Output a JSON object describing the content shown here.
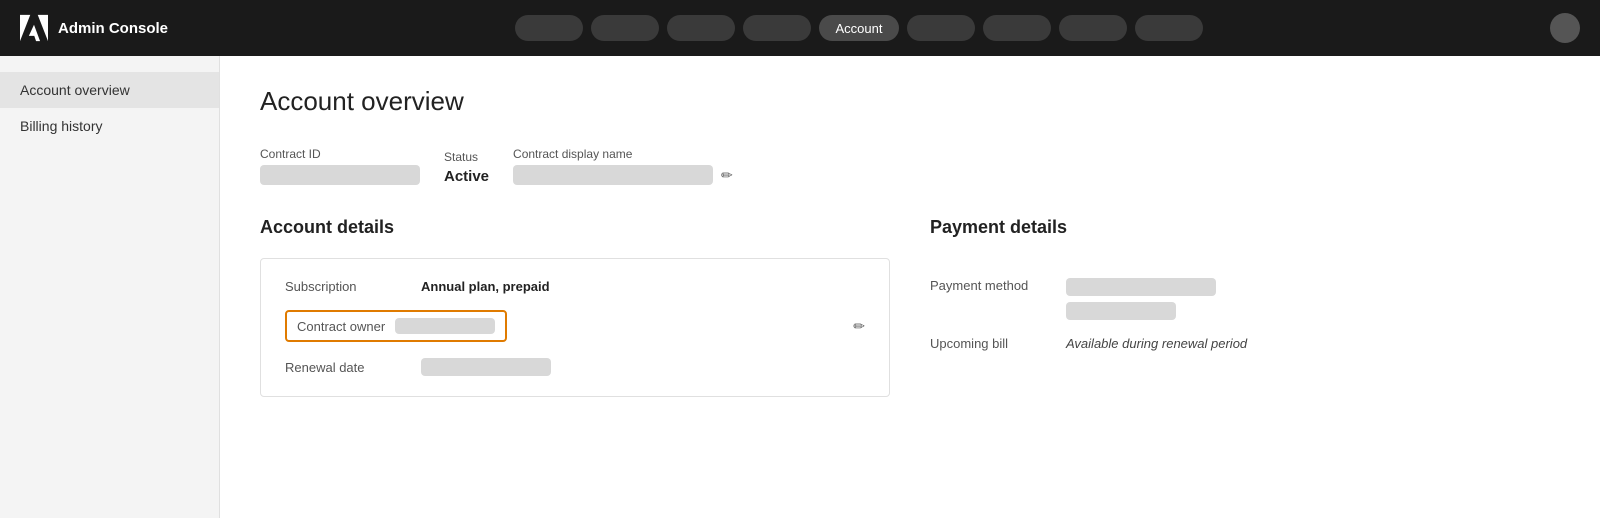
{
  "topnav": {
    "logo_text": "Admin Console",
    "nav_pills": [
      {
        "id": "p1",
        "label": ""
      },
      {
        "id": "p2",
        "label": ""
      },
      {
        "id": "p3",
        "label": ""
      },
      {
        "id": "p4",
        "label": ""
      },
      {
        "id": "p5",
        "label": "Account",
        "active": true
      },
      {
        "id": "p6",
        "label": ""
      },
      {
        "id": "p7",
        "label": ""
      },
      {
        "id": "p8",
        "label": ""
      },
      {
        "id": "p9",
        "label": ""
      }
    ]
  },
  "sidebar": {
    "items": [
      {
        "id": "account-overview",
        "label": "Account overview",
        "active": true
      },
      {
        "id": "billing-history",
        "label": "Billing history",
        "active": false
      }
    ]
  },
  "content": {
    "page_title": "Account overview",
    "contract_id_label": "Contract ID",
    "status_label": "Status",
    "status_value": "Active",
    "contract_display_name_label": "Contract display name",
    "account_details_title": "Account details",
    "subscription_label": "Subscription",
    "subscription_value": "Annual plan, prepaid",
    "contract_owner_label": "Contract owner",
    "renewal_date_label": "Renewal date",
    "payment_details_title": "Payment details",
    "payment_method_label": "Payment method",
    "upcoming_bill_label": "Upcoming bill",
    "upcoming_bill_value": "Available during renewal period"
  }
}
